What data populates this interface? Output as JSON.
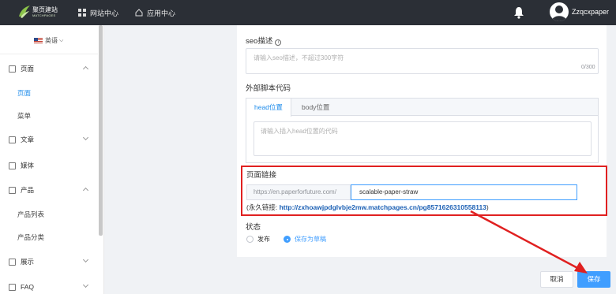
{
  "brand": {
    "name": "聚页建站",
    "subtitle": "MATCHPAGES",
    "accent_color": "#409eff",
    "topbar_color": "#2b2f36",
    "annotation_color": "#e02020"
  },
  "topbar": {
    "nav": [
      {
        "label": "网站中心",
        "icon": "grid-icon"
      },
      {
        "label": "应用中心",
        "icon": "home-icon"
      }
    ],
    "username": "Zzqcxpaper"
  },
  "sidebar": {
    "language": "英语",
    "items": [
      {
        "label": "页面",
        "icon": "page-icon",
        "expanded": true
      },
      {
        "label": "页面",
        "active": true
      },
      {
        "label": "菜单"
      },
      {
        "label": "文章",
        "icon": "article-icon",
        "expanded": false
      },
      {
        "label": "媒体",
        "icon": "media-icon"
      },
      {
        "label": "产品",
        "icon": "product-icon",
        "expanded": true
      },
      {
        "label": "产品列表"
      },
      {
        "label": "产品分类"
      },
      {
        "label": "展示",
        "icon": "display-icon",
        "expanded": false
      },
      {
        "label": "FAQ",
        "icon": "faq-icon",
        "expanded": false
      }
    ]
  },
  "form": {
    "seo_desc_label": "seo描述",
    "seo_desc_placeholder": "请输入seo描述，不超过300字符",
    "seo_desc_counter": "0/300",
    "script_label": "外部脚本代码",
    "tabs": [
      "head位置",
      "body位置"
    ],
    "script_placeholder": "请输入插入head位置的代码",
    "page_link_label": "页面链接",
    "url_prefix": "https://en.paperforfuture.com/",
    "slug_value": "scalable-paper-straw",
    "permalink_prefix": "(永久链接: ",
    "permalink_url": "http://zxhoawjpdglvbje2mw.matchpages.cn/pg8571626310558113",
    "permalink_suffix": ")",
    "status_label": "状态",
    "status_options": [
      "发布",
      "保存为草稿"
    ],
    "status_selected": "保存为草稿"
  },
  "actions": {
    "cancel": "取消",
    "save": "保存"
  }
}
